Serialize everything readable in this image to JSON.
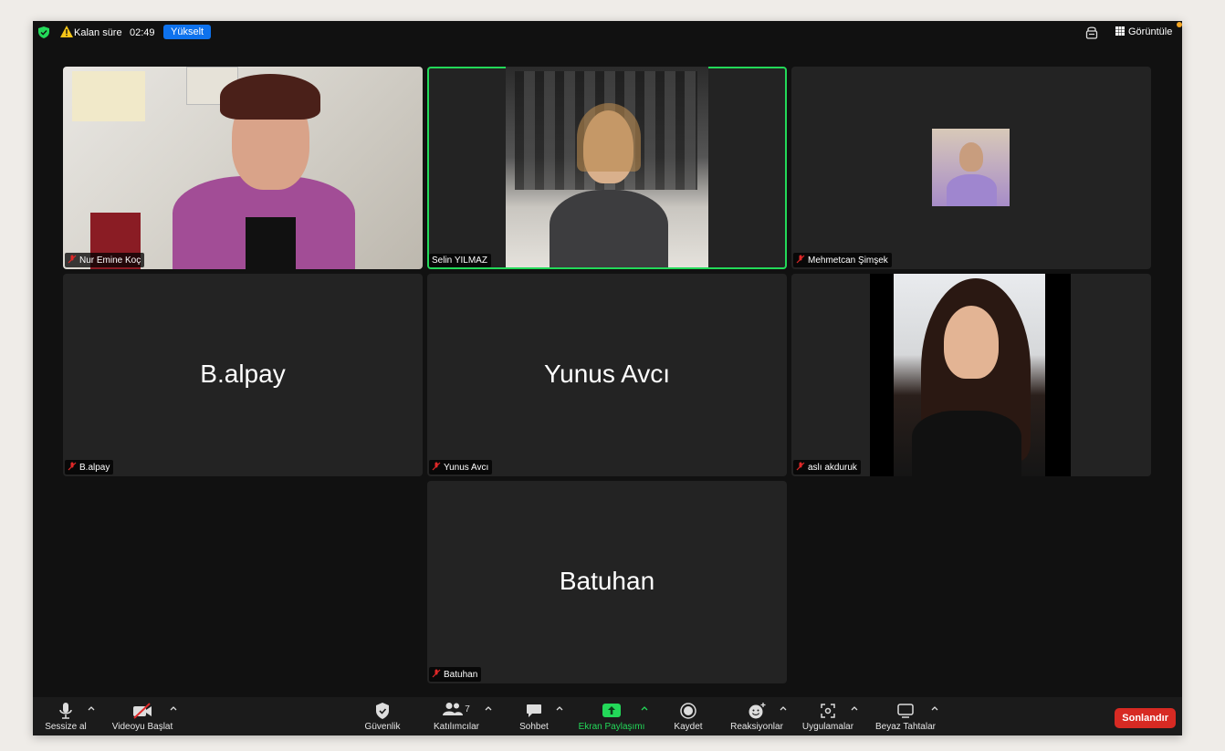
{
  "topbar": {
    "timer_label": "Kalan süre",
    "timer_value": "02:49",
    "upgrade_label": "Yükselt",
    "view_label": "Görüntüle"
  },
  "participants": [
    {
      "name": "Nur Emine Koç",
      "video": true,
      "muted": true
    },
    {
      "name": "Selin YILMAZ",
      "video": true,
      "muted": false,
      "speaking": true
    },
    {
      "name": "Mehmetcan Şimşek",
      "video": true,
      "muted": true
    },
    {
      "name": "B.alpay",
      "video": false,
      "muted": true
    },
    {
      "name": "Yunus Avcı",
      "video": false,
      "muted": true
    },
    {
      "name": "aslı akduruk",
      "video": true,
      "muted": true
    },
    {
      "name": "Batuhan",
      "video": false,
      "muted": true
    }
  ],
  "toolbar": {
    "mute_label": "Sessize al",
    "video_label": "Videoyu Başlat",
    "security_label": "Güvenlik",
    "participants_label": "Katılımcılar",
    "participants_count": "7",
    "chat_label": "Sohbet",
    "share_label": "Ekran Paylaşımı",
    "record_label": "Kaydet",
    "reactions_label": "Reaksiyonlar",
    "apps_label": "Uygulamalar",
    "whiteboard_label": "Beyaz Tahtalar",
    "end_label": "Sonlandır"
  },
  "colors": {
    "active_speaker": "#23d959",
    "upgrade": "#0e72ed",
    "end": "#d72a23",
    "muted_icon": "#e02828"
  }
}
